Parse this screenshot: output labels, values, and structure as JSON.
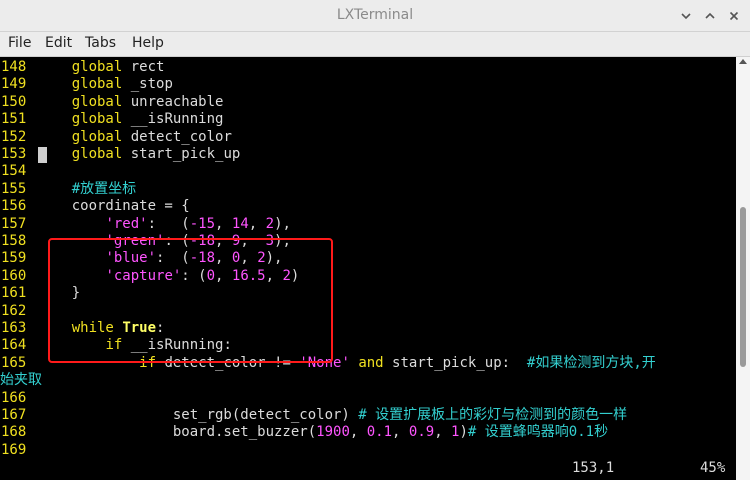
{
  "window": {
    "title": "LXTerminal",
    "icons": [
      "chevron-down-icon",
      "chevron-up-icon",
      "close-icon"
    ]
  },
  "menu": {
    "file": "File",
    "edit": "Edit",
    "tabs": "Tabs",
    "help": "Help"
  },
  "code": {
    "lines": [
      {
        "n": "148",
        "segs": [
          {
            "t": "    "
          },
          {
            "t": "global",
            "c": "kw"
          },
          {
            "t": " rect"
          }
        ]
      },
      {
        "n": "149",
        "segs": [
          {
            "t": "    "
          },
          {
            "t": "global",
            "c": "kw"
          },
          {
            "t": " _stop"
          }
        ]
      },
      {
        "n": "150",
        "segs": [
          {
            "t": "    "
          },
          {
            "t": "global",
            "c": "kw"
          },
          {
            "t": " unreachable"
          }
        ]
      },
      {
        "n": "151",
        "segs": [
          {
            "t": "    "
          },
          {
            "t": "global",
            "c": "kw"
          },
          {
            "t": " __isRunning"
          }
        ]
      },
      {
        "n": "152",
        "segs": [
          {
            "t": "    "
          },
          {
            "t": "global",
            "c": "kw"
          },
          {
            "t": " detect_color"
          }
        ]
      },
      {
        "n": "153",
        "segs": [
          {
            "t": "    "
          },
          {
            "t": "global",
            "c": "kw"
          },
          {
            "t": " start_pick_up"
          }
        ]
      },
      {
        "n": "154",
        "segs": []
      },
      {
        "n": "155",
        "segs": [
          {
            "t": "    "
          },
          {
            "t": "#放置坐标",
            "c": "com"
          }
        ]
      },
      {
        "n": "156",
        "segs": [
          {
            "t": "    coordinate = {"
          }
        ]
      },
      {
        "n": "157",
        "segs": [
          {
            "t": "        "
          },
          {
            "t": "'red'",
            "c": "str"
          },
          {
            "t": ":   ("
          },
          {
            "t": "-15",
            "c": "num"
          },
          {
            "t": ", "
          },
          {
            "t": "14",
            "c": "num"
          },
          {
            "t": ", "
          },
          {
            "t": "2",
            "c": "num"
          },
          {
            "t": "),"
          }
        ]
      },
      {
        "n": "158",
        "segs": [
          {
            "t": "        "
          },
          {
            "t": "'green'",
            "c": "str"
          },
          {
            "t": ": ("
          },
          {
            "t": "-18",
            "c": "num"
          },
          {
            "t": ", "
          },
          {
            "t": "9",
            "c": "num"
          },
          {
            "t": ",  "
          },
          {
            "t": "3",
            "c": "num"
          },
          {
            "t": "),"
          }
        ]
      },
      {
        "n": "159",
        "segs": [
          {
            "t": "        "
          },
          {
            "t": "'blue'",
            "c": "str"
          },
          {
            "t": ":  ("
          },
          {
            "t": "-18",
            "c": "num"
          },
          {
            "t": ", "
          },
          {
            "t": "0",
            "c": "num"
          },
          {
            "t": ", "
          },
          {
            "t": "2",
            "c": "num"
          },
          {
            "t": "),"
          }
        ]
      },
      {
        "n": "160",
        "segs": [
          {
            "t": "        "
          },
          {
            "t": "'capture'",
            "c": "str"
          },
          {
            "t": ": ("
          },
          {
            "t": "0",
            "c": "num"
          },
          {
            "t": ", "
          },
          {
            "t": "16.5",
            "c": "num"
          },
          {
            "t": ", "
          },
          {
            "t": "2",
            "c": "num"
          },
          {
            "t": ")"
          }
        ]
      },
      {
        "n": "161",
        "segs": [
          {
            "t": "    }"
          }
        ]
      },
      {
        "n": "162",
        "segs": []
      },
      {
        "n": "163",
        "segs": [
          {
            "t": "    "
          },
          {
            "t": "while",
            "c": "kw"
          },
          {
            "t": " "
          },
          {
            "t": "True",
            "c": "kwb"
          },
          {
            "t": ":"
          }
        ]
      },
      {
        "n": "164",
        "segs": [
          {
            "t": "        "
          },
          {
            "t": "if",
            "c": "kw"
          },
          {
            "t": " __isRunning:"
          }
        ]
      },
      {
        "n": "165",
        "segs": [
          {
            "t": "            "
          },
          {
            "t": "if",
            "c": "kw"
          },
          {
            "t": " detect_color != "
          },
          {
            "t": "'None'",
            "c": "str"
          },
          {
            "t": " "
          },
          {
            "t": "and",
            "c": "kw"
          },
          {
            "t": " start_pick_up:  "
          },
          {
            "t": "#如果检测到方块,开",
            "c": "com"
          }
        ]
      },
      {
        "n": "",
        "segs": [
          {
            "t": "始夹取",
            "c": "com"
          }
        ],
        "wrap": true
      },
      {
        "n": "166",
        "segs": []
      },
      {
        "n": "167",
        "segs": [
          {
            "t": "                set_rgb(detect_color) "
          },
          {
            "t": "# 设置扩展板上的彩灯与检测到的颜色一样",
            "c": "com"
          }
        ]
      },
      {
        "n": "168",
        "segs": [
          {
            "t": "                board.set_buzzer("
          },
          {
            "t": "1900",
            "c": "num"
          },
          {
            "t": ", "
          },
          {
            "t": "0.1",
            "c": "num"
          },
          {
            "t": ", "
          },
          {
            "t": "0.9",
            "c": "num"
          },
          {
            "t": ", "
          },
          {
            "t": "1",
            "c": "num"
          },
          {
            "t": ")"
          },
          {
            "t": "# 设置蜂鸣器响0.1秒",
            "c": "com"
          }
        ]
      },
      {
        "n": "169",
        "segs": []
      }
    ]
  },
  "status": {
    "position": "153,1",
    "percent": "45%"
  }
}
